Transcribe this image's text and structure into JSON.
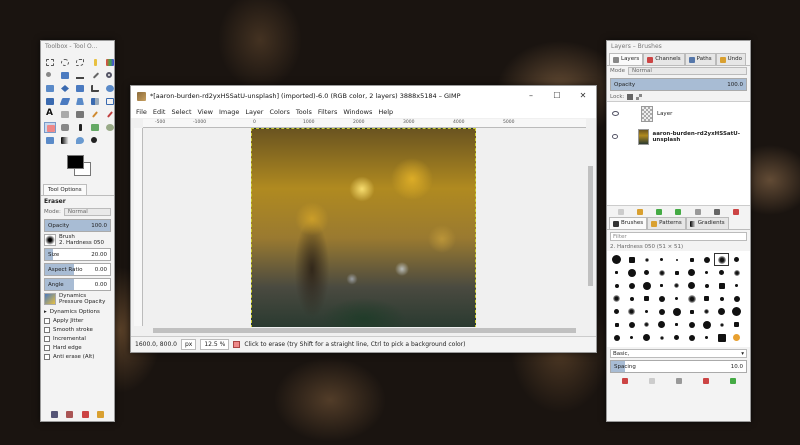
{
  "toolbox": {
    "title": "Toolbox - Tool O...",
    "tab_tool_options": "Tool Options",
    "tool_name": "Eraser",
    "mode_label": "Mode:",
    "mode_value": "Normal",
    "opacity_label": "Opacity",
    "opacity_value": "100.0",
    "brush_label": "Brush",
    "brush_value": "2. Hardness 050",
    "size_label": "Size",
    "size_value": "20.00",
    "aspect_label": "Aspect Ratio",
    "aspect_value": "0.00",
    "angle_label": "Angle",
    "angle_value": "0.00",
    "dynamics_label": "Dynamics",
    "dynamics_value": "Pressure Opacity",
    "dynamics_options": "Dynamics Options",
    "checks": [
      "Apply Jitter",
      "Smooth stroke",
      "Incremental",
      "Hard edge",
      "Anti erase  (Alt)"
    ],
    "fg_color": "#000000",
    "bg_color": "#ffffff"
  },
  "image_window": {
    "title": "*[aaron-burden-rd2yxHSSatU-unsplash] (imported)-6.0 (RGB color, 2 layers) 3888x5184 – GIMP",
    "menu": [
      "File",
      "Edit",
      "Select",
      "View",
      "Image",
      "Layer",
      "Colors",
      "Tools",
      "Filters",
      "Windows",
      "Help"
    ],
    "ruler_marks": [
      "-500",
      "-1000",
      "0",
      "1000",
      "2000",
      "3000",
      "4000",
      "5000"
    ],
    "coords": "1600.0, 800.0",
    "unit": "px",
    "zoom": "12.5 %",
    "status_message": "Click to erase (try Shift for a straight line, Ctrl to pick a background color)"
  },
  "layers_dock": {
    "title": "Layers – Brushes",
    "tabs": [
      "Layers",
      "Channels",
      "Paths",
      "Undo"
    ],
    "mode_label": "Mode",
    "mode_value": "Normal",
    "opacity_label": "Opacity",
    "opacity_value": "100.0",
    "lock_label": "Lock:",
    "layers": [
      {
        "name": "Layer",
        "bold": false
      },
      {
        "name": "aaron-burden-rd2yxHSSatU-unsplash",
        "bold": true
      }
    ],
    "brush_tabs": [
      "Brushes",
      "Patterns",
      "Gradients"
    ],
    "filter_placeholder": "Filter",
    "brush_selected": "2. Hardness 050 (51 × 51)",
    "brush_set": "Basic,",
    "spacing_label": "Spacing",
    "spacing_value": "10.0"
  }
}
